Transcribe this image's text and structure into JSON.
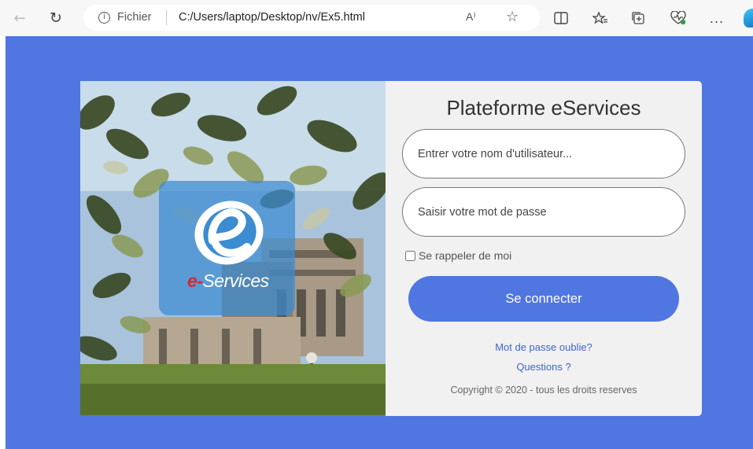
{
  "browser": {
    "address_label": "Fichier",
    "url": "C:/Users/laptop/Desktop/nv/Ex5.html",
    "icons": [
      "back-arrow-icon",
      "reload-icon",
      "info-icon",
      "read-aloud-icon",
      "favorite-star-icon",
      "split-screen-icon",
      "favorites-icon",
      "collections-icon",
      "browser-essentials-icon",
      "more-icon",
      "copilot-icon"
    ],
    "more_label": "...",
    "read_aloud_label": "A⁾"
  },
  "logo": {
    "prefix": "e",
    "dash": "-",
    "name": "Services"
  },
  "login": {
    "title": "Plateforme eServices",
    "username_placeholder": "Entrer votre nom d'utilisateur...",
    "password_placeholder": "Saisir votre mot de passe",
    "username_value": "",
    "password_value": "",
    "remember_label": "Se rappeler de moi",
    "remember_checked": false,
    "submit_label": "Se connecter",
    "forgot_link": "Mot de passe oublie?",
    "questions_link": "Questions ?",
    "copyright": "Copyright © 2020 - tous les droits reserves"
  },
  "colors": {
    "page_background": "#4f76e1",
    "button": "#4f76e1",
    "link": "#3f64cf",
    "panel": "#f1f1f1",
    "logo_overlay": "#3c8cd2",
    "logo_dash": "#d8262e"
  }
}
